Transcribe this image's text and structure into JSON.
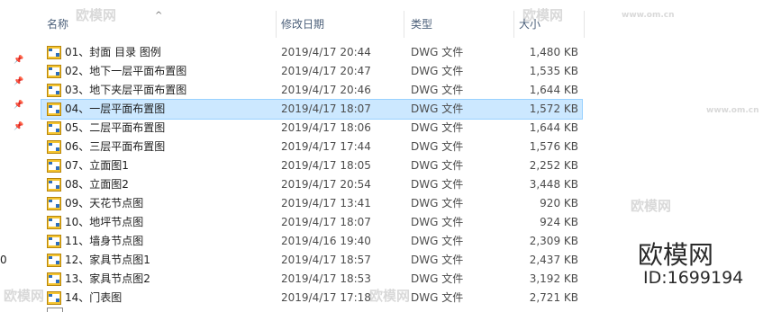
{
  "columns": {
    "name": "名称",
    "date": "修改日期",
    "type": "类型",
    "size": "大小"
  },
  "stray_char": "0",
  "files": [
    {
      "name": "01、封面 目录 图例",
      "date": "2019/4/17 20:44",
      "type": "DWG 文件",
      "size": "1,480 KB"
    },
    {
      "name": "02、地下一层平面布置图",
      "date": "2019/4/17 20:47",
      "type": "DWG 文件",
      "size": "1,535 KB"
    },
    {
      "name": "03、地下夹层平面布置图",
      "date": "2019/4/17 20:46",
      "type": "DWG 文件",
      "size": "1,644 KB"
    },
    {
      "name": "04、一层平面布置图",
      "date": "2019/4/17 18:07",
      "type": "DWG 文件",
      "size": "1,572 KB",
      "selected": true
    },
    {
      "name": "05、二层平面布置图",
      "date": "2019/4/17 18:06",
      "type": "DWG 文件",
      "size": "1,644 KB"
    },
    {
      "name": "06、三层平面布置图",
      "date": "2019/4/17 17:44",
      "type": "DWG 文件",
      "size": "1,576 KB"
    },
    {
      "name": "07、立面图1",
      "date": "2019/4/17 18:05",
      "type": "DWG 文件",
      "size": "2,252 KB"
    },
    {
      "name": "08、立面图2",
      "date": "2019/4/17 20:54",
      "type": "DWG 文件",
      "size": "3,448 KB"
    },
    {
      "name": "09、天花节点图",
      "date": "2019/4/17 13:41",
      "type": "DWG 文件",
      "size": "920 KB"
    },
    {
      "name": "10、地坪节点图",
      "date": "2019/4/17 18:07",
      "type": "DWG 文件",
      "size": "924 KB"
    },
    {
      "name": "11、墙身节点图",
      "date": "2019/4/16 19:40",
      "type": "DWG 文件",
      "size": "2,309 KB"
    },
    {
      "name": "12、家具节点图1",
      "date": "2019/4/17 18:57",
      "type": "DWG 文件",
      "size": "2,437 KB"
    },
    {
      "name": "13、家具节点图2",
      "date": "2019/4/17 18:53",
      "type": "DWG 文件",
      "size": "3,192 KB"
    },
    {
      "name": "14、门表图",
      "date": "2019/4/17 17:18",
      "type": "DWG 文件",
      "size": "2,721 KB"
    }
  ],
  "icons": {
    "file": "dwg-file-icon",
    "pin": "pin-icon",
    "sort": "sort-ascending-icon"
  },
  "colors": {
    "selection": "#cce8ff",
    "selection_border": "#99d1ff",
    "header_text": "#4c607a"
  },
  "watermark": {
    "brand": "欧模网",
    "id": "ID:1699194",
    "small": "欧模网",
    "url": "www.om.cn"
  }
}
